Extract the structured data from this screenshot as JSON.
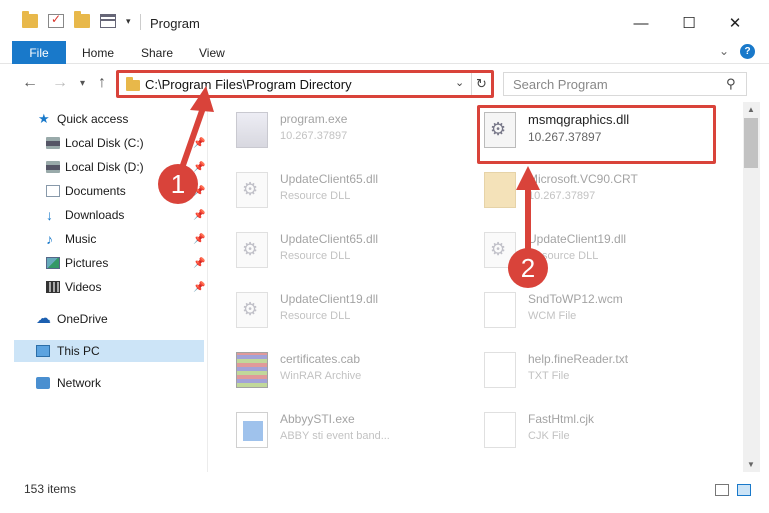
{
  "window": {
    "title": "Program",
    "minimize": "—",
    "maximize": "☐",
    "close": "✕"
  },
  "ribbon": {
    "file_tab": "File",
    "tabs": [
      "Home",
      "Share",
      "View"
    ],
    "help": "?"
  },
  "navbar": {
    "address": "C:\\Program Files\\Program Directory",
    "search_placeholder": "Search Program"
  },
  "sidebar": {
    "items": [
      {
        "label": "Quick access",
        "icon": "star-icon",
        "pinned": false
      },
      {
        "label": "Local Disk (C:)",
        "icon": "disk-icon",
        "pinned": true
      },
      {
        "label": "Local Disk (D:)",
        "icon": "disk-icon",
        "pinned": true
      },
      {
        "label": "Documents",
        "icon": "documents-icon",
        "pinned": true
      },
      {
        "label": "Downloads",
        "icon": "download-icon",
        "pinned": true
      },
      {
        "label": "Music",
        "icon": "music-icon",
        "pinned": true
      },
      {
        "label": "Pictures",
        "icon": "pictures-icon",
        "pinned": true
      },
      {
        "label": "Videos",
        "icon": "videos-icon",
        "pinned": true
      },
      {
        "label": "OneDrive",
        "icon": "cloud-icon",
        "pinned": false
      },
      {
        "label": "This PC",
        "icon": "pc-icon",
        "pinned": false,
        "selected": true
      },
      {
        "label": "Network",
        "icon": "network-icon",
        "pinned": false
      }
    ]
  },
  "files": [
    {
      "name": "program.exe",
      "sub": "10.267.37897",
      "icon": "exe-icon"
    },
    {
      "name": "msmqgraphics.dll",
      "sub": "10.267.37897",
      "icon": "dll-gear-icon",
      "highlighted": true
    },
    {
      "name": "UpdateClient65.dll",
      "sub": "Resource DLL",
      "icon": "dll-gear-icon"
    },
    {
      "name": "Microsoft.VC90.CRT",
      "sub": "10.267.37897",
      "icon": "folder-icon"
    },
    {
      "name": "UpdateClient65.dll",
      "sub": "Resource DLL",
      "icon": "dll-gear-icon"
    },
    {
      "name": "UpdateClient19.dll",
      "sub": "Resource DLL",
      "icon": "dll-gear-icon"
    },
    {
      "name": "UpdateClient19.dll",
      "sub": "Resource DLL",
      "icon": "dll-gear-icon"
    },
    {
      "name": "SndToWP12.wcm",
      "sub": "WCM File",
      "icon": "file-icon"
    },
    {
      "name": "certificates.cab",
      "sub": "WinRAR Archive",
      "icon": "archive-icon"
    },
    {
      "name": "help.fineReader.txt",
      "sub": "TXT File",
      "icon": "file-icon"
    },
    {
      "name": "AbbyySTI.exe",
      "sub": "ABBY sti event band...",
      "icon": "app-icon"
    },
    {
      "name": "FastHtml.cjk",
      "sub": "CJK File",
      "icon": "file-icon"
    }
  ],
  "status": {
    "count": "153 items"
  },
  "annotations": {
    "step1": "1",
    "step2": "2",
    "color": "#d9433a"
  }
}
